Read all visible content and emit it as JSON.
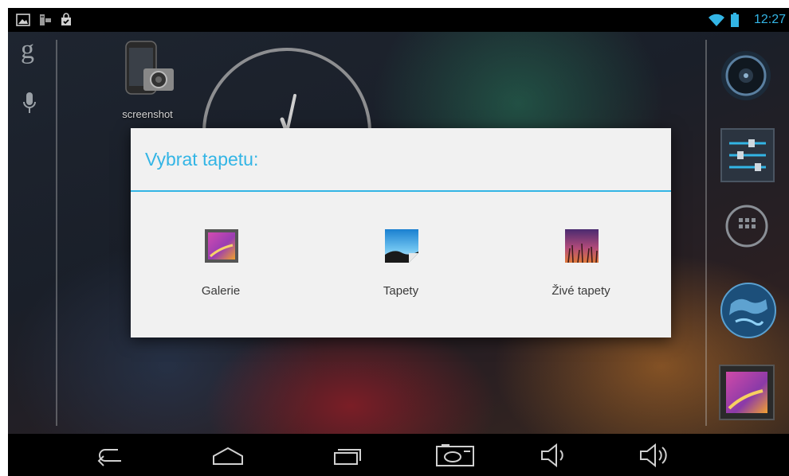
{
  "status_bar": {
    "time": "12:27",
    "icons_left": [
      "image-notification-icon",
      "usb-debug-icon",
      "store-update-icon"
    ],
    "icons_right": [
      "wifi-icon",
      "battery-icon"
    ],
    "accent": "#33b5e5"
  },
  "search_bar": {
    "icons": [
      "google-search-icon",
      "microphone-icon"
    ],
    "google_glyph": "g"
  },
  "desktop": {
    "shortcut_label": "screenshot",
    "widgets": [
      "analog-clock"
    ]
  },
  "dock": {
    "items": [
      "music-app-icon",
      "settings-app-icon",
      "all-apps-icon",
      "browser-app-icon",
      "gallery-app-icon"
    ]
  },
  "dialog": {
    "title": "Vybrat tapetu:",
    "options": [
      {
        "label": "Galerie",
        "icon": "gallery-icon"
      },
      {
        "label": "Tapety",
        "icon": "wallpapers-icon"
      },
      {
        "label": "Živé tapety",
        "icon": "live-wallpapers-icon"
      }
    ]
  },
  "nav_bar": {
    "buttons": [
      "back-button",
      "home-button",
      "recents-button",
      "screenshot-button",
      "volume-down-button",
      "volume-up-button"
    ]
  }
}
